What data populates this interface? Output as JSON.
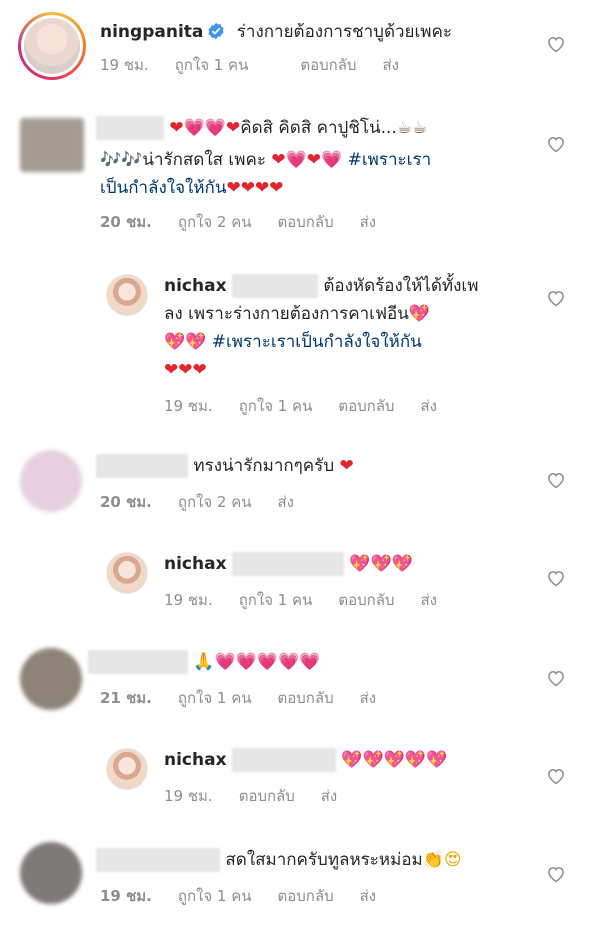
{
  "comments": [
    {
      "user": "ningpanita",
      "verified": true,
      "text": "ร่างกายต้องการชาบูด้วยเพคะ",
      "time": "19 ชม.",
      "likes": "ถูกใจ 1 คน",
      "reply": "ตอบกลับ",
      "send": "ส่ง"
    },
    {
      "line1_emoji_a": "❤💗💗❤",
      "line1_text": "คิดสิ คิดสิ คาปูชิโน่...",
      "line1_emoji_b": "☕☕",
      "line2_emoji": "🎶🎶",
      "line2_text": "น่ารักสดใส เพคะ",
      "line2_emoji_b": "❤💗❤💗",
      "line2_tag": "#เพราะเรา",
      "line3_tag": "เป็นกำลังใจให้กัน",
      "line3_emoji": "❤❤❤❤",
      "time": "20 ชม.",
      "likes": "ถูกใจ 2 คน",
      "reply": "ตอบกลับ",
      "send": "ส่ง"
    },
    {
      "user": "nichax",
      "line1_text": "ต้องหัดร้องให้ได้ทั้งเพ",
      "line2_text": "ลง เพราะร่างกายต้องการคาเฟอีน",
      "line2_emoji": "💖",
      "line3_emoji": "💖💖",
      "line3_tag": "#เพราะเราเป็นกำลังใจให้กัน",
      "line4_emoji": "❤❤❤",
      "time": "19 ชม.",
      "likes": "ถูกใจ 1 คน",
      "reply": "ตอบกลับ",
      "send": "ส่ง"
    },
    {
      "text": "ทรงน่ารักมากๆครับ",
      "emoji": "❤",
      "time": "20 ชม.",
      "likes": "ถูกใจ 2 คน",
      "send": "ส่ง"
    },
    {
      "user": "nichax",
      "emoji": "💖💖💖",
      "time": "19 ชม.",
      "likes": "ถูกใจ 1 คน",
      "reply": "ตอบกลับ",
      "send": "ส่ง"
    },
    {
      "emoji": "🙏💗💗💗💗💗",
      "time": "21 ชม.",
      "likes": "ถูกใจ 1 คน",
      "reply": "ตอบกลับ",
      "send": "ส่ง"
    },
    {
      "user": "nichax",
      "emoji": "💖💖💖💖💖",
      "time": "19 ชม.",
      "reply": "ตอบกลับ",
      "send": "ส่ง"
    },
    {
      "text": "สดใสมากครับทูลหระหม่อม",
      "emoji": "👏😍",
      "time": "19 ชม.",
      "likes": "ถูกใจ 1 คน",
      "reply": "ตอบกลับ",
      "send": "ส่ง"
    }
  ],
  "colors": {
    "meta": "#8e8e8e",
    "hashtag": "#00376b",
    "text": "#262626",
    "verified": "#3897f0"
  },
  "icons": {
    "like": "heart-outline-icon",
    "verified": "verified-badge-icon"
  }
}
